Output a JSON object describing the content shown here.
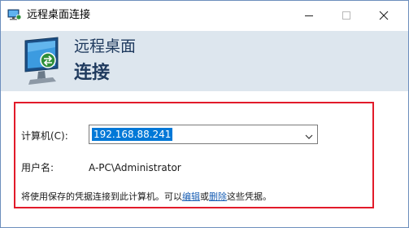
{
  "window": {
    "title": "远程桌面连接"
  },
  "banner": {
    "heading_line1": "远程桌面",
    "heading_line2": "连接"
  },
  "form": {
    "computer_label": "计算机(C):",
    "computer_value": "192.168.88.241",
    "username_label": "用户名:",
    "username_value": "A-PC\\Administrator"
  },
  "note": {
    "prefix": "将使用保存的凭据连接到此计算机。可以",
    "edit_link": "编辑",
    "middle": "或",
    "delete_link": "删除",
    "suffix": "这些凭据。"
  },
  "icons": {
    "app": "remote-desktop-icon",
    "banner": "monitor-connection-icon",
    "minimize": "minimize-icon",
    "maximize": "maximize-icon",
    "close": "close-icon",
    "dropdown": "chevron-down-icon"
  },
  "colors": {
    "banner_bg": "#dde6ee",
    "heading": "#1f3a5e",
    "highlight": "#e21b2a",
    "selection": "#0078d7",
    "link": "#1a5fb4"
  }
}
